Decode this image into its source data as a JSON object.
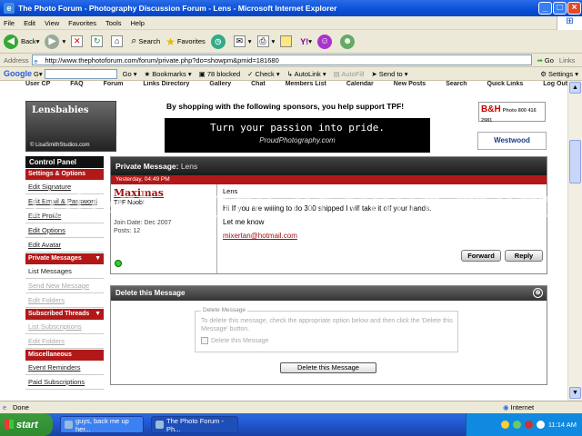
{
  "window": {
    "title": "The Photo Forum - Photography Discussion Forum - Lens - Microsoft Internet Explorer"
  },
  "menu": [
    "File",
    "Edit",
    "View",
    "Favorites",
    "Tools",
    "Help"
  ],
  "toolbar": {
    "back": "Back",
    "search": "Search",
    "favorites": "Favorites"
  },
  "address": {
    "label": "Address",
    "url": "http://www.thephotoforum.com/forum/private.php?do=showpm&pmid=181680",
    "go": "Go",
    "links": "Links"
  },
  "google": {
    "logo": "Google",
    "go": "Go",
    "bookmarks": "Bookmarks",
    "blocked": "78 blocked",
    "check": "Check",
    "autolink": "AutoLink",
    "autofill": "AutoFill",
    "sendto": "Send to",
    "settings": "Settings"
  },
  "forum_nav": [
    "User CP",
    "FAQ",
    "Forum",
    "Links Directory",
    "Gallery",
    "Chat",
    "Members List",
    "Calendar",
    "New Posts",
    "Search",
    "Quick Links",
    "Log Out"
  ],
  "sponsor": {
    "lensbabies": "Lensbabies",
    "lensbabies_credit": "© LisaSmithStudios.com",
    "text": "By shopping with the following sponsors, you help support TPF!",
    "banner_line1": "Turn your passion into pride.",
    "banner_line2": "ProudPhotography.com",
    "bh": "B&H",
    "bh_sub": "Photo 800 416 2981",
    "westwood": "Westwood"
  },
  "sidebar": {
    "control_panel": "Control Panel",
    "settings_header": "Settings & Options",
    "settings_items": [
      "Edit Signature",
      "Edit Email & Password",
      "Edit Profile",
      "Edit Options",
      "Edit Avatar"
    ],
    "pm_header": "Private Messages",
    "pm_items": [
      "List Messages",
      "Send New Message",
      "Edit Folders"
    ],
    "subscribed_header": "Subscribed Threads",
    "subscribed_items": [
      "List Subscriptions",
      "Edit Folders"
    ],
    "misc_header": "Miscellaneous",
    "misc_items": [
      "Event Reminders",
      "Paid Subscriptions"
    ]
  },
  "pm": {
    "header_label": "Private Message:",
    "header_subject": "Lens",
    "date": "Yesterday, 04:49 PM",
    "username": "Maximas",
    "rank": "TPF Noob!",
    "join_date": "Join Date: Dec 2007",
    "posts": "Posts: 12",
    "subject": "Lens",
    "body_line1": "Hi If you are willing to do 300 shipped I will take it off your hands.",
    "body_line2": "Let me know",
    "email": "mixertan@hotmail.com",
    "forward": "Forward",
    "reply": "Reply"
  },
  "delete": {
    "title": "Delete this Message",
    "legend": "Delete Message",
    "desc": "To delete this message, check the appropriate option below and then click the 'Delete this Message' button.",
    "checkbox": "Delete this Message",
    "button": "Delete this Message"
  },
  "watermark": "Protect more of your memories for less!",
  "status": {
    "done": "Done",
    "zone": "Internet"
  },
  "taskbar": {
    "start": "start",
    "task1": "guys, back me up her...",
    "task2": "The Photo Forum - Ph...",
    "clock": "11:14 AM"
  }
}
